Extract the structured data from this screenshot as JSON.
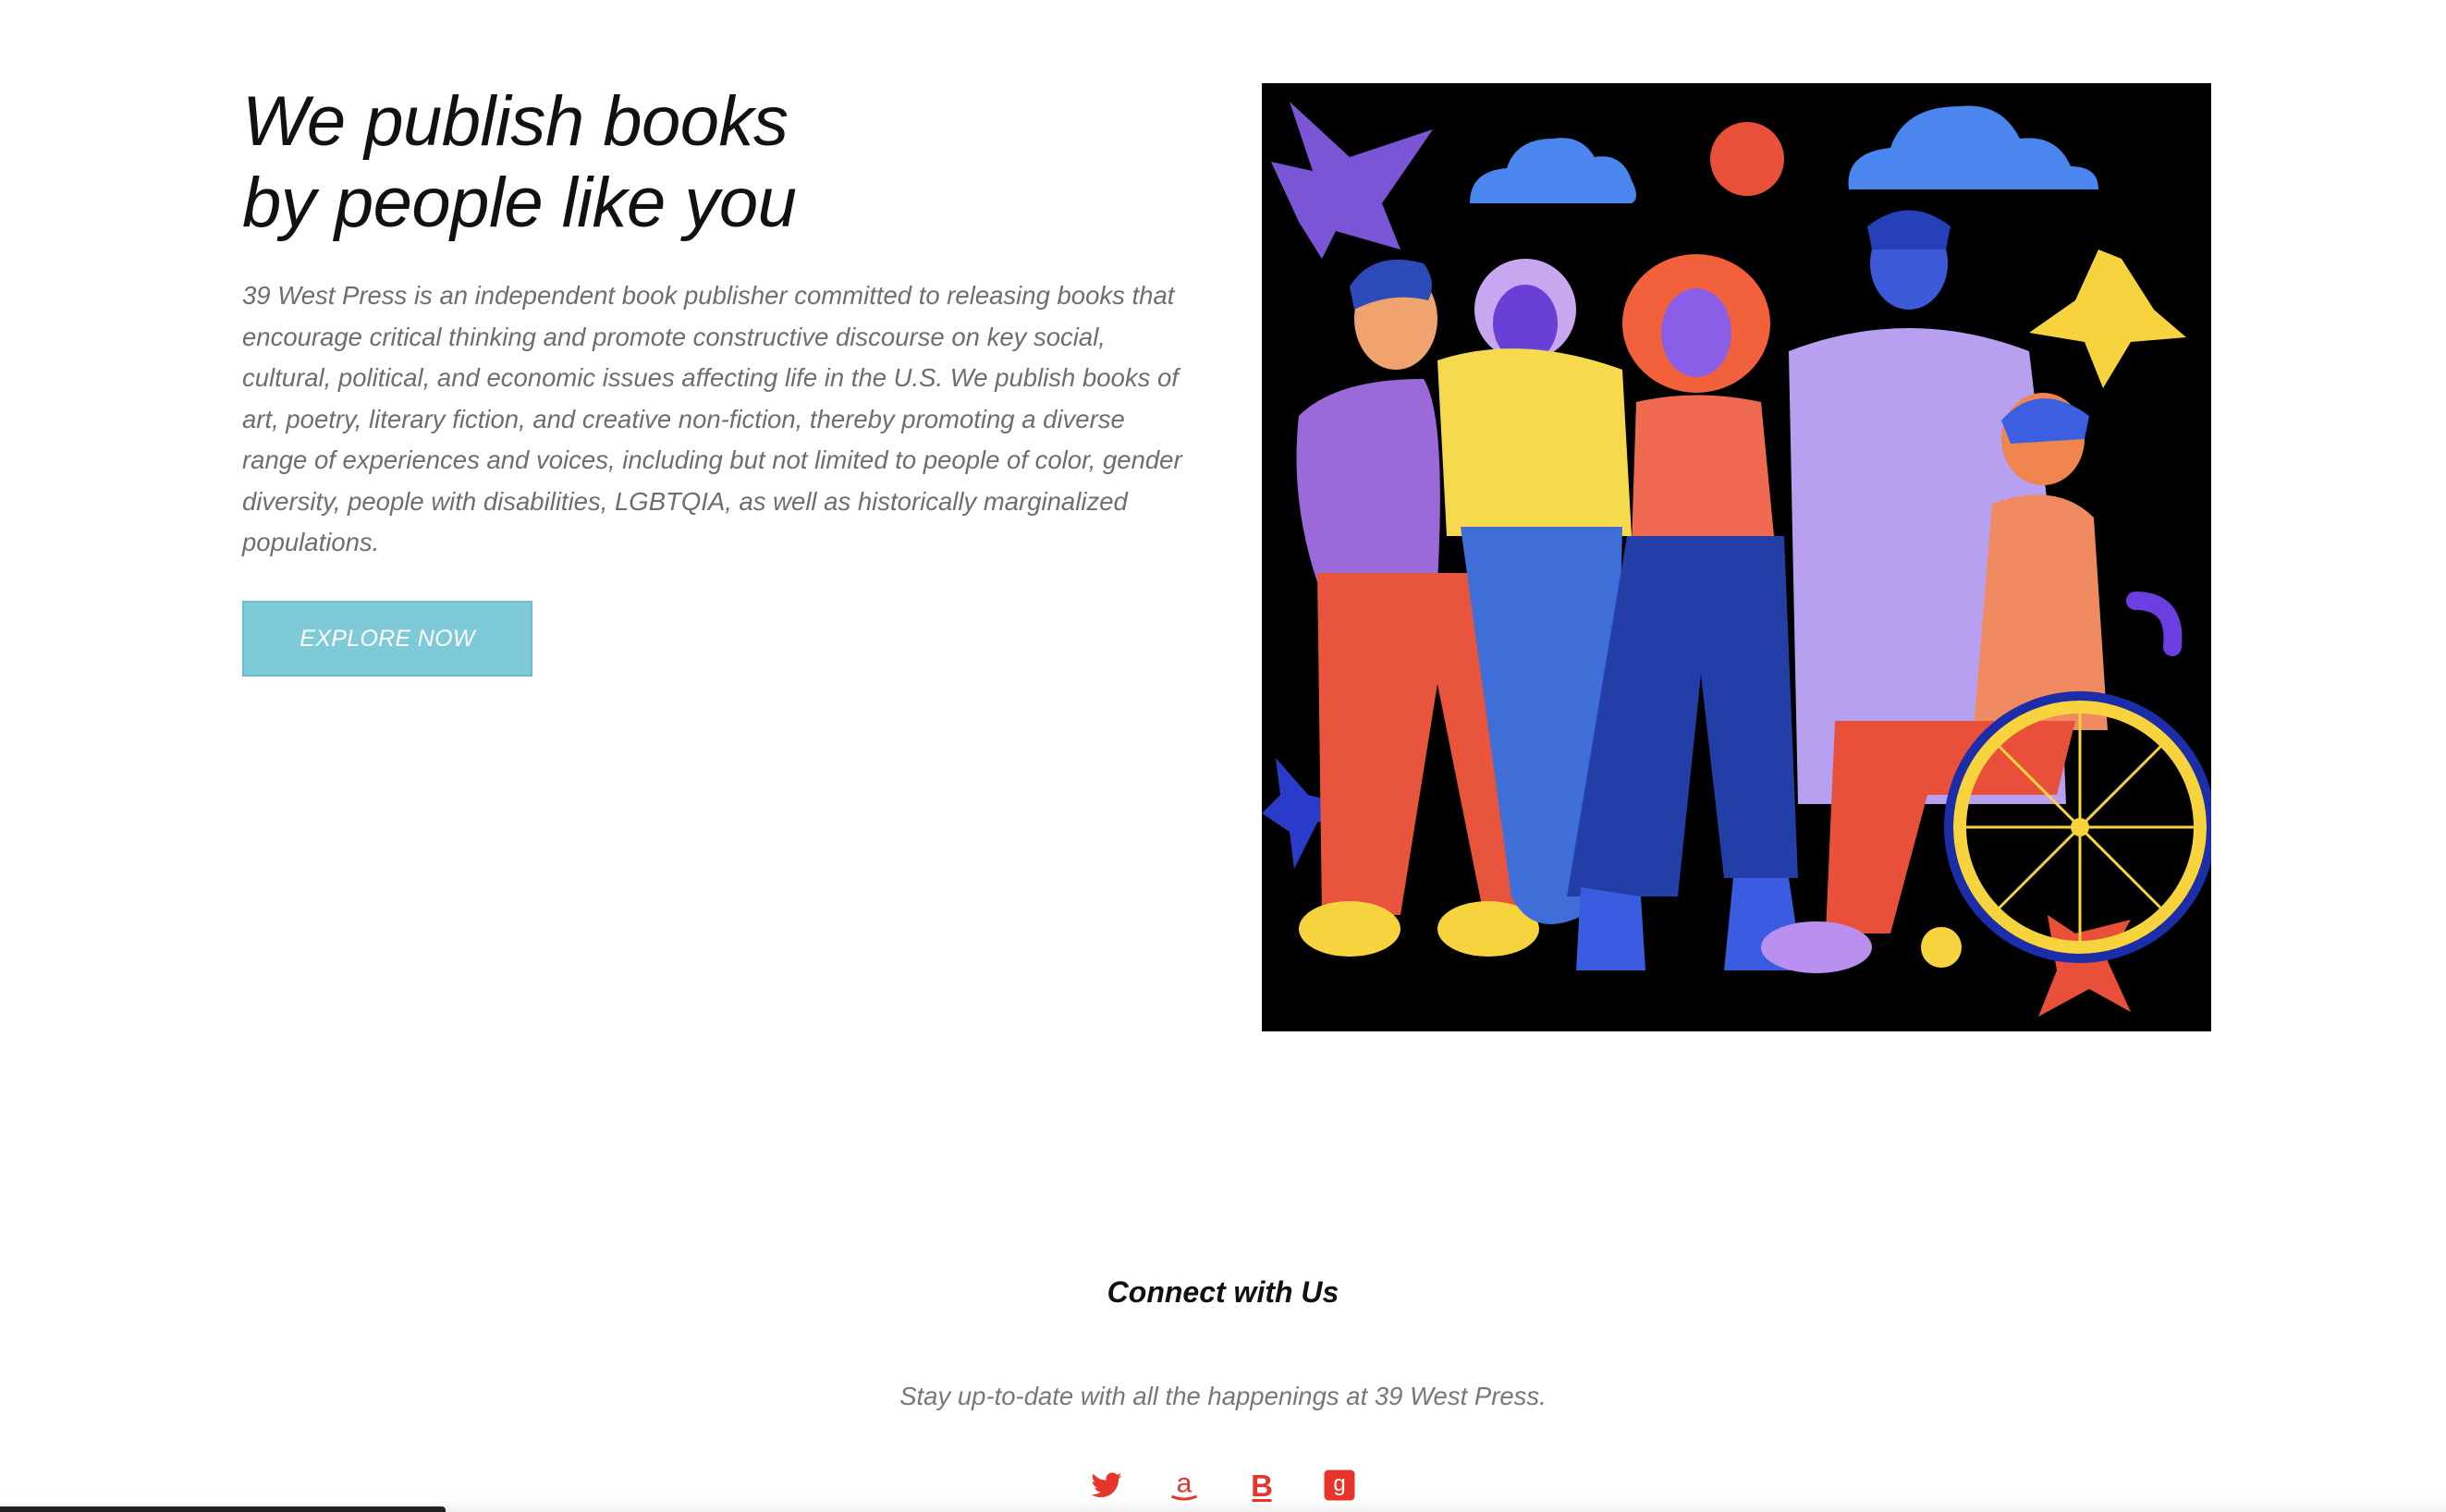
{
  "hero": {
    "headline_line1": "We publish books",
    "headline_line2": "by people like you",
    "intro": "39 West Press is an independent book publisher committed to releasing books that encourage critical thinking and promote constructive discourse on key social, cultural, political, and economic issues affecting life in the U.S. We publish books of art, poetry, literary fiction, and creative non-fiction, thereby promoting a diverse range of experiences and voices, including but not limited to people of color, gender diversity, people with disabilities, LGBTQIA, as well as historically marginalized populations.",
    "button_label": "EXPLORE NOW"
  },
  "connect": {
    "title": "Connect with Us",
    "subtitle": "Stay up-to-date with all the happenings at 39 West Press.",
    "icons": [
      "twitter-icon",
      "amazon-icon",
      "bookbub-icon",
      "goodreads-icon"
    ]
  },
  "colors": {
    "button_bg": "#7ecad9",
    "social_red": "#e8352c",
    "headline": "#111111",
    "body_text": "#6e6e6e"
  }
}
